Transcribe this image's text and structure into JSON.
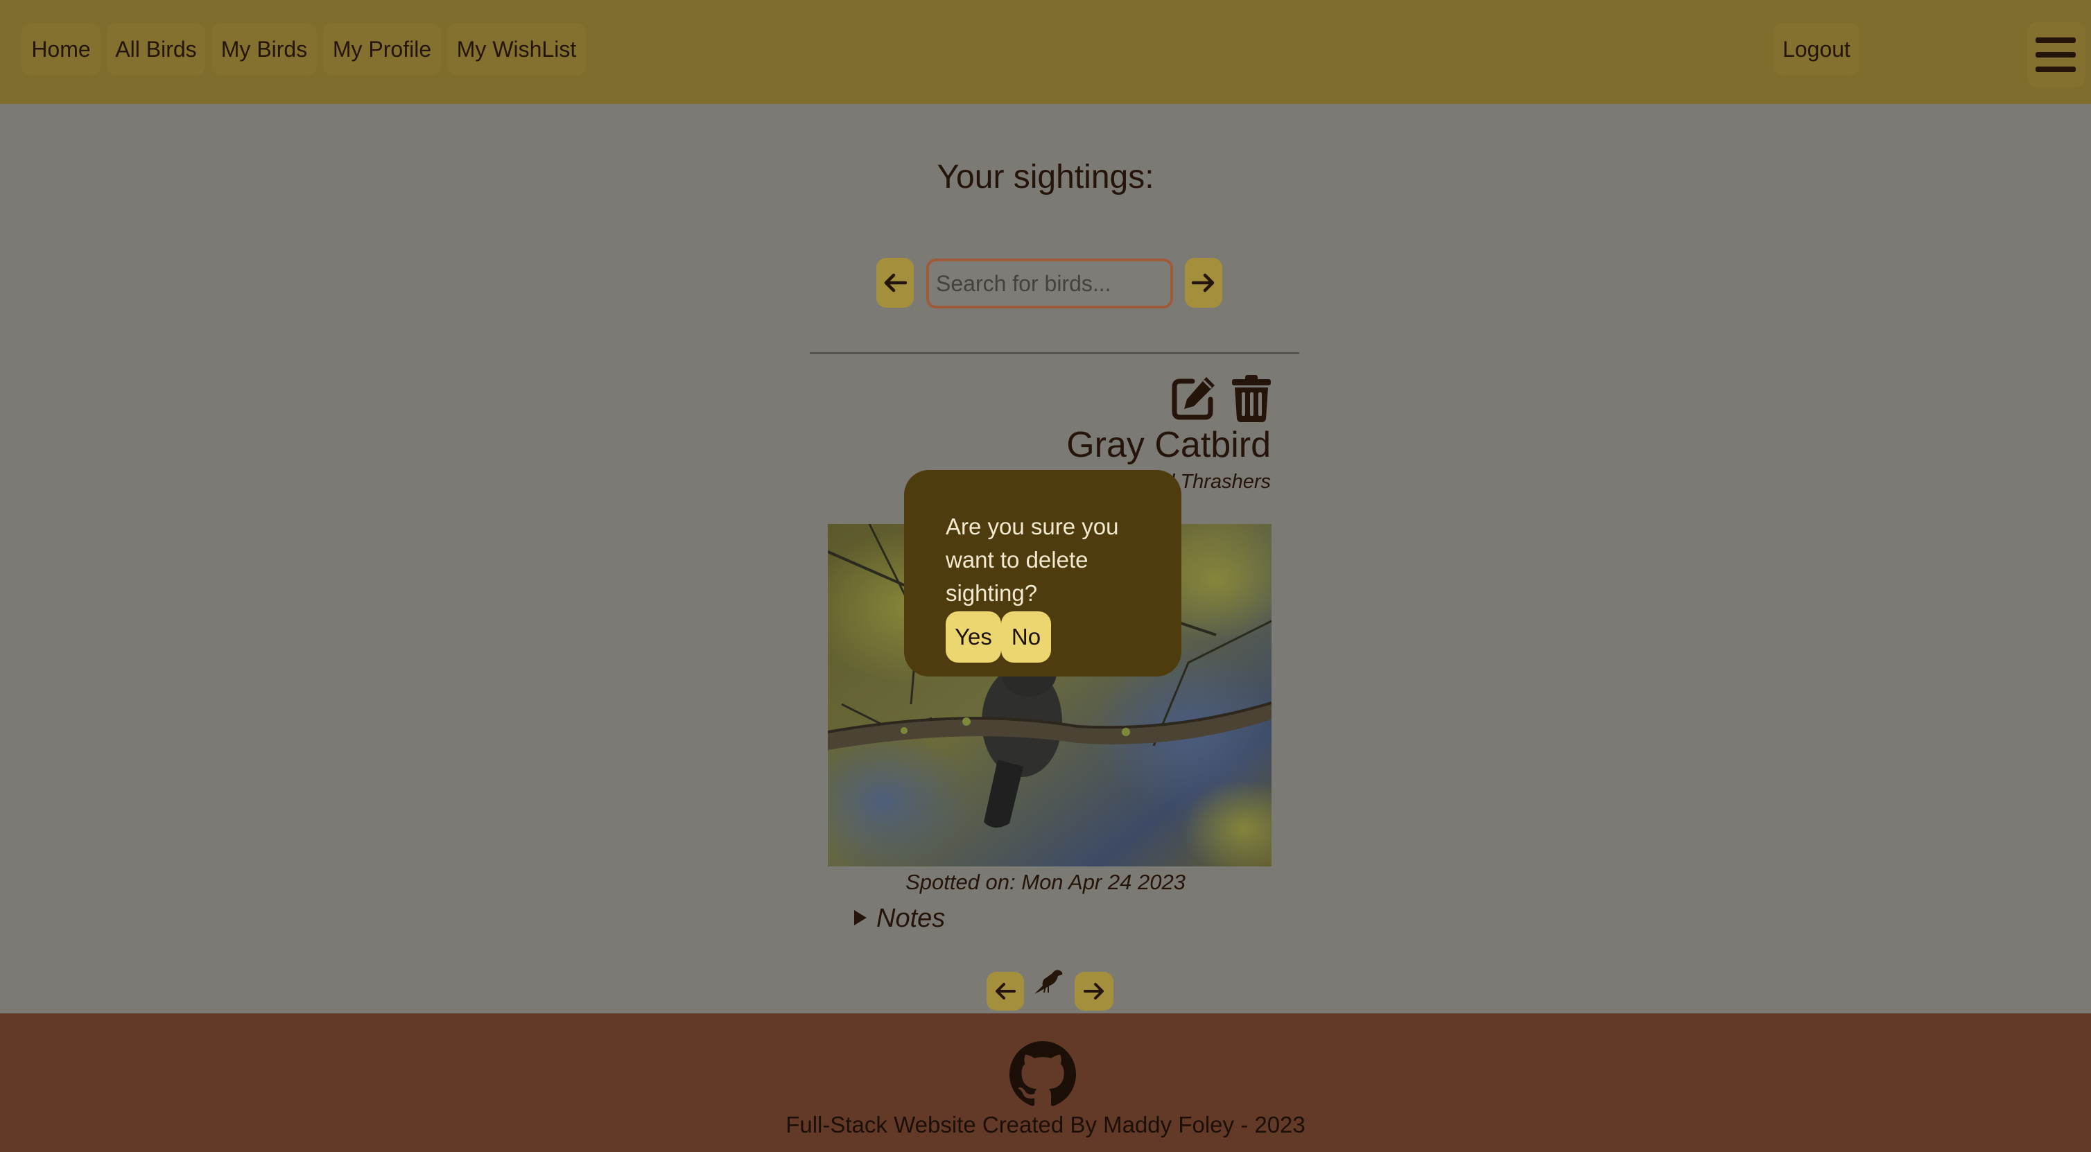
{
  "nav": {
    "items": [
      "Home",
      "All Birds",
      "My Birds",
      "My Profile",
      "My WishList"
    ],
    "logout_label": "Logout"
  },
  "main": {
    "title": "Your sightings:",
    "search_placeholder": "Search for birds...",
    "sighting": {
      "bird_name": "Gray Catbird",
      "family": "Family: Mockingbirds and Thrashers",
      "spotted": "Spotted on: Mon Apr 24 2023",
      "notes_label": "Notes"
    }
  },
  "dialog": {
    "message": "Are you sure you want to delete sighting?",
    "yes_label": "Yes",
    "no_label": "No"
  },
  "footer": {
    "credit": "Full-Stack Website Created By Maddy Foley - 2023"
  },
  "icons": {
    "menu": "hamburger-menu-icon",
    "prev": "arrow-left-icon",
    "next": "arrow-right-icon",
    "edit": "edit-icon",
    "delete": "trash-icon",
    "bird": "bird-icon",
    "github": "github-icon"
  },
  "colors": {
    "header": "#7f6d2e",
    "background": "#7b7a74",
    "accent_button": "#a38f3c",
    "dialog": "#4e3b0e",
    "dialog_button": "#ecd670",
    "footer": "#633a28"
  }
}
